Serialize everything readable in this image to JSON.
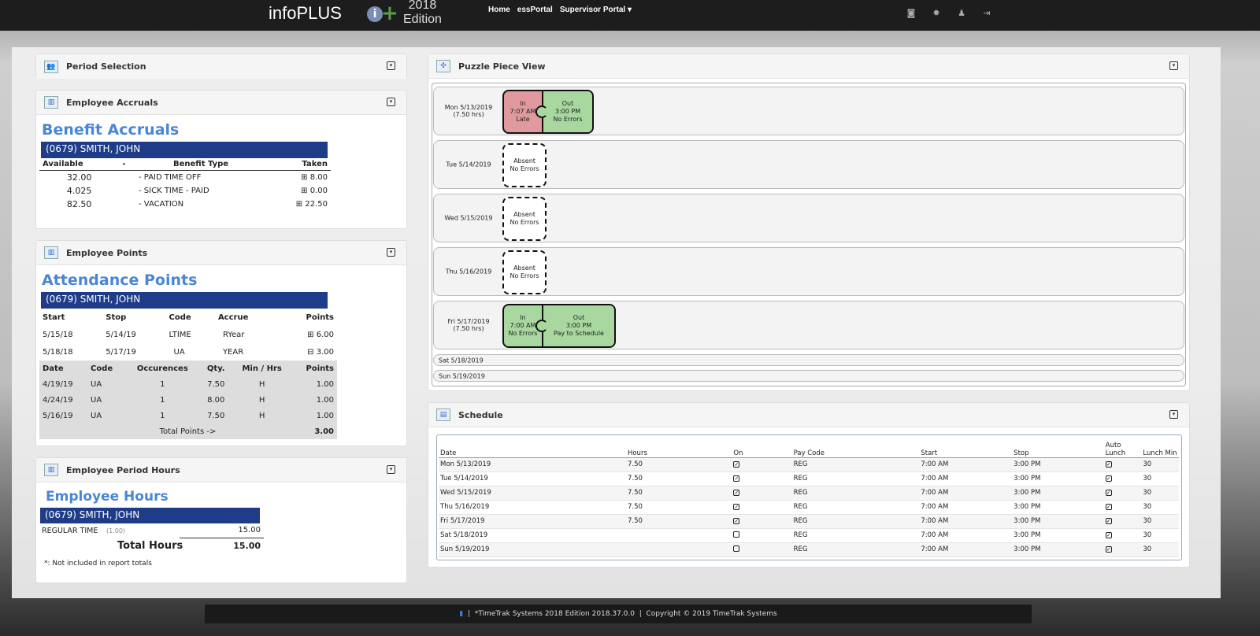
{
  "topbar": {
    "brand": "infoPLUS",
    "edition_year": "2018",
    "edition_word": "Edition",
    "nav": [
      "Home",
      "essPortal",
      "Supervisor Portal ▾"
    ],
    "icons": [
      "camera-icon",
      "gear-icon",
      "user-icon",
      "logout-icon"
    ]
  },
  "period_selection": {
    "title": "Period Selection"
  },
  "accruals": {
    "title": "Employee Accruals",
    "heading": "Benefit Accruals",
    "employee": "(0679) SMITH, JOHN",
    "headers": [
      "Available",
      "-",
      "Benefit Type",
      "Taken"
    ],
    "rows": [
      [
        "32.00",
        "- PAID TIME OFF",
        "8.00"
      ],
      [
        "4.025",
        "- SICK TIME - PAID",
        "0.00"
      ],
      [
        "82.50",
        "- VACATION",
        "22.50"
      ]
    ]
  },
  "points": {
    "title": "Employee Points",
    "heading": "Attendance Points",
    "employee": "(0679) SMITH, JOHN",
    "headers": [
      "Start",
      "Stop",
      "Code",
      "Accrue",
      "Points"
    ],
    "rows": [
      [
        "5/15/18",
        "5/14/19",
        "LTIME",
        "RYear",
        "6.00",
        "⊞"
      ],
      [
        "5/18/18",
        "5/17/19",
        "UA",
        "YEAR",
        "3.00",
        "⊟"
      ]
    ],
    "detail_headers": [
      "Date",
      "Code",
      "Occurences",
      "Qty.",
      "Min / Hrs",
      "Points"
    ],
    "detail_rows": [
      [
        "4/19/19",
        "UA",
        "1",
        "7.50",
        "H",
        "1.00"
      ],
      [
        "4/24/19",
        "UA",
        "1",
        "8.00",
        "H",
        "1.00"
      ],
      [
        "5/16/19",
        "UA",
        "1",
        "7.50",
        "H",
        "1.00"
      ]
    ],
    "total_label": "Total Points ->",
    "total": "3.00"
  },
  "hours": {
    "title": "Employee Period Hours",
    "heading": "Employee Hours",
    "employee": "(0679) SMITH, JOHN",
    "line_label": "REGULAR TIME",
    "line_rate": "(1.00)",
    "line_value": "15.00",
    "total_label": "Total Hours",
    "total": "15.00",
    "note": "*: Not included in report totals"
  },
  "puzzle": {
    "title": "Puzzle Piece View",
    "days": [
      {
        "label": "Mon 5/13/2019",
        "hours": "(7.50 hrs)",
        "in": [
          "In",
          "7:07 AM",
          "Late"
        ],
        "out": [
          "Out",
          "3:00 PM",
          "No Errors"
        ],
        "in_color": "#e09a9e"
      },
      {
        "label": "Tue 5/14/2019",
        "absent": [
          "Absent",
          "No Errors"
        ]
      },
      {
        "label": "Wed 5/15/2019",
        "absent": [
          "Absent",
          "No Errors"
        ]
      },
      {
        "label": "Thu 5/16/2019",
        "absent": [
          "Absent",
          "No Errors"
        ]
      },
      {
        "label": "Fri 5/17/2019",
        "hours": "(7.50 hrs)",
        "in": [
          "In",
          "7:00 AM",
          "No Errors"
        ],
        "out": [
          "Out",
          "3:00 PM",
          "Pay to Schedule"
        ],
        "in_color": "#a8d8a0"
      },
      {
        "label": "Sat 5/18/2019"
      },
      {
        "label": "Sun 5/19/2019"
      }
    ]
  },
  "schedule": {
    "title": "Schedule",
    "headers": [
      "Date",
      "Hours",
      "On",
      "Pay Code",
      "Start",
      "Stop",
      "Auto Lunch",
      "Lunch Min"
    ],
    "rows": [
      [
        "Mon 5/13/2019",
        "7.50",
        true,
        "REG",
        "7:00 AM",
        "3:00 PM",
        true,
        "30"
      ],
      [
        "Tue 5/14/2019",
        "7.50",
        true,
        "REG",
        "7:00 AM",
        "3:00 PM",
        true,
        "30"
      ],
      [
        "Wed 5/15/2019",
        "7.50",
        true,
        "REG",
        "7:00 AM",
        "3:00 PM",
        true,
        "30"
      ],
      [
        "Thu 5/16/2019",
        "7.50",
        true,
        "REG",
        "7:00 AM",
        "3:00 PM",
        true,
        "30"
      ],
      [
        "Fri 5/17/2019",
        "7.50",
        true,
        "REG",
        "7:00 AM",
        "3:00 PM",
        true,
        "30"
      ],
      [
        "Sat 5/18/2019",
        "",
        false,
        "REG",
        "7:00 AM",
        "3:00 PM",
        true,
        "30"
      ],
      [
        "Sun 5/19/2019",
        "",
        false,
        "REG",
        "7:00 AM",
        "3:00 PM",
        true,
        "30"
      ]
    ]
  },
  "footer": {
    "version": "*TimeTrak Systems 2018 Edition 2018.37.0.0",
    "copyright": "Copyright © 2019 TimeTrak Systems"
  },
  "colors": {
    "accent": "#4a86d6",
    "namebar": "#1f3c88",
    "late": "#e09a9e",
    "ok": "#a8d8a0"
  }
}
